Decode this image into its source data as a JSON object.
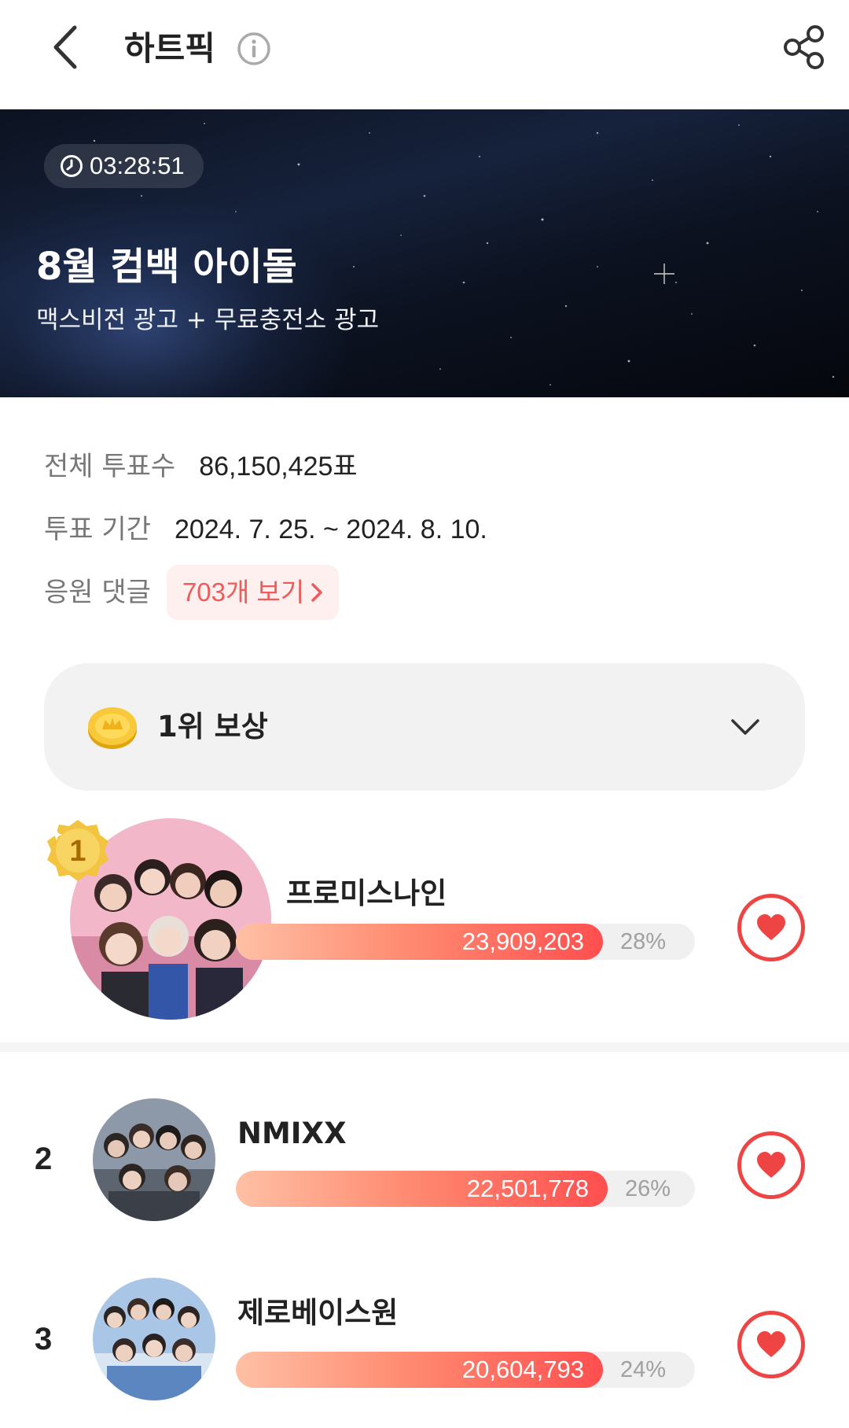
{
  "header": {
    "title": "하트픽",
    "icons": [
      "back-arrow-icon",
      "info-icon",
      "share-icon"
    ]
  },
  "banner": {
    "timer": "03:28:51",
    "title": "8월 컴백 아이돌",
    "subtitle": "맥스비전 광고 + 무료충전소 광고"
  },
  "info": {
    "total_votes_label": "전체 투표수",
    "total_votes_value": "86,150,425표",
    "period_label": "투표 기간",
    "period_value": "2024. 7. 25. ~ 2024. 8. 10.",
    "comments_label": "응원 댓글",
    "comments_link": "703개 보기"
  },
  "reward": {
    "label": "1위 보상"
  },
  "colors": {
    "accent": "#ef4444",
    "bar_start": "#ffc0a5",
    "bar_end": "#ff4f4f",
    "chip_bg": "#fff0f0",
    "chip_text": "#ef5a5a"
  },
  "ranking": [
    {
      "rank": "1",
      "name": "프로미스나인",
      "votes": "23,909,203",
      "percent": "28%",
      "fill": 0.8
    },
    {
      "rank": "2",
      "name": "NMIXX",
      "votes": "22,501,778",
      "percent": "26%",
      "fill": 0.81
    },
    {
      "rank": "3",
      "name": "제로베이스원",
      "votes": "20,604,793",
      "percent": "24%",
      "fill": 0.8
    }
  ]
}
